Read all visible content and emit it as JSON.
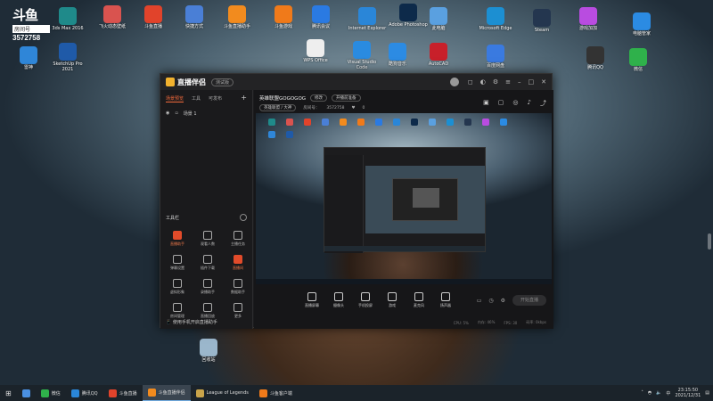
{
  "overlay": {
    "logo": "斗鱼",
    "tag": "房间号",
    "room_number": "3572758"
  },
  "desktop_icons": [
    {
      "label": "3ds Max 2016",
      "color": "#1f8a8a"
    },
    {
      "label": "飞火动态壁纸",
      "color": "#d9534f"
    },
    {
      "label": "斗鱼直播",
      "color": "#e1432b"
    },
    {
      "label": "快捷方式",
      "color": "#4a7fd6"
    },
    {
      "label": "斗鱼直播助手",
      "color": "#f28b1e"
    },
    {
      "label": "斗鱼游戏",
      "color": "#f07a1a"
    },
    {
      "label": "腾讯会议",
      "color": "#2a7ae2"
    },
    {
      "label": "Internet Explorer",
      "color": "#2a86d8"
    },
    {
      "label": "Adobe Photoshop",
      "color": "#0d2a4a"
    },
    {
      "label": "此电脑",
      "color": "#5aa0e0"
    },
    {
      "label": "Microsoft Edge",
      "color": "#1c8fd2"
    },
    {
      "label": "Steam",
      "color": "#24364f"
    },
    {
      "label": "游戏加加",
      "color": "#b94ce0"
    },
    {
      "label": "电脑管家",
      "color": "#2b8be3"
    },
    {
      "label": "雷神",
      "color": "#2f86d8"
    },
    {
      "label": "SketchUp Pro 2021",
      "color": "#1f5aa8"
    },
    {
      "label": "WPS Office",
      "color": "#eeeeee"
    },
    {
      "label": "Visual Studio Code",
      "color": "#2a8be0"
    },
    {
      "label": "酷狗音乐",
      "color": "#2c8be3"
    },
    {
      "label": "AutoCAD",
      "color": "#c8202a"
    },
    {
      "label": "百度网盘",
      "color": "#3a7ae0"
    },
    {
      "label": "腾讯QQ",
      "color": "#333333"
    },
    {
      "label": "微信",
      "color": "#2fb14b"
    },
    {
      "label": "回收站",
      "color": "#9bb7cc"
    }
  ],
  "app": {
    "brand": "直播伴侣",
    "version": "测试版",
    "left_tabs": [
      "场景预览",
      "工具",
      "可发布"
    ],
    "scene_label": "场景 1",
    "tools_header": "工具栏",
    "tools": [
      {
        "label": "直播助手",
        "hot": true
      },
      {
        "label": "观看人数",
        "hot": false
      },
      {
        "label": "主播任务",
        "hot": false
      },
      {
        "label": "弹幕设置",
        "hot": false
      },
      {
        "label": "插件下载",
        "hot": false
      },
      {
        "label": "直播间",
        "hot": true
      },
      {
        "label": "虚拟形象",
        "hot": false
      },
      {
        "label": "录播助手",
        "hot": false
      },
      {
        "label": "数据助手",
        "hot": false
      },
      {
        "label": "房间管理",
        "hot": false
      },
      {
        "label": "直播回放",
        "hot": false
      },
      {
        "label": "更多",
        "hot": false
      }
    ],
    "mobile_tip": "使用手机开启直播助手",
    "room_title": "英雄联盟GOGOGOG",
    "room_title_chip": "修改",
    "room_extra_chip": "开播前准备",
    "room_category": "英雄联盟 / 大神",
    "room_id_label": "房间号：",
    "room_id": "3572758",
    "followers": "0",
    "actions": [
      "直播屏幕",
      "摄像头",
      "手机投屏",
      "游戏",
      "麦克风",
      "扬声器"
    ],
    "golive": "开始直播",
    "status": [
      "CPU: 5%",
      "内存: 46%",
      "FPS: 30",
      "码率: 0kbps"
    ]
  },
  "taskbar": {
    "items": [
      {
        "label": "微信",
        "color": "#2fb14b",
        "active": false
      },
      {
        "label": "腾讯QQ",
        "color": "#2a86d8",
        "active": false
      },
      {
        "label": "斗鱼直播",
        "color": "#e1432b",
        "active": false
      },
      {
        "label": "斗鱼直播伴侣",
        "color": "#f28b1e",
        "active": true
      },
      {
        "label": "League of Legends",
        "color": "#c9a44a",
        "active": false
      },
      {
        "label": "斗鱼客户端",
        "color": "#f07a1a",
        "active": false
      }
    ],
    "time": "23:15:50",
    "date": "2021/12/31"
  }
}
